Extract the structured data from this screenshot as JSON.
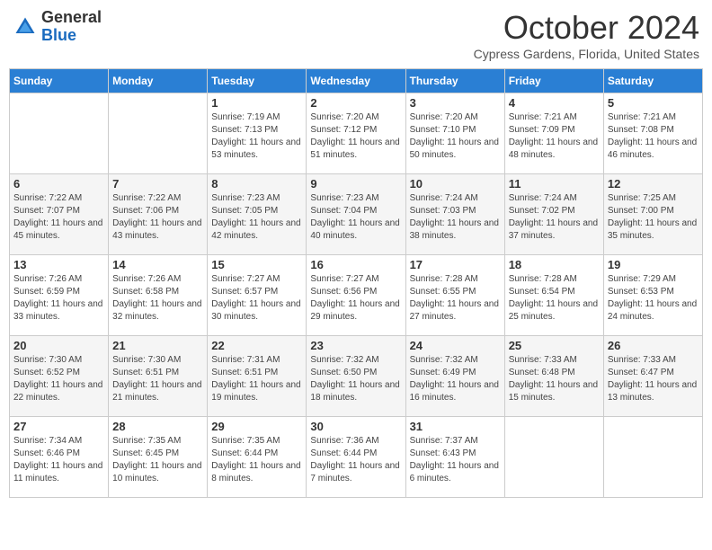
{
  "header": {
    "logo": {
      "general": "General",
      "blue": "Blue"
    },
    "title": "October 2024",
    "location": "Cypress Gardens, Florida, United States"
  },
  "days_of_week": [
    "Sunday",
    "Monday",
    "Tuesday",
    "Wednesday",
    "Thursday",
    "Friday",
    "Saturday"
  ],
  "weeks": [
    [
      {
        "day": "",
        "info": ""
      },
      {
        "day": "",
        "info": ""
      },
      {
        "day": "1",
        "info": "Sunrise: 7:19 AM\nSunset: 7:13 PM\nDaylight: 11 hours and 53 minutes."
      },
      {
        "day": "2",
        "info": "Sunrise: 7:20 AM\nSunset: 7:12 PM\nDaylight: 11 hours and 51 minutes."
      },
      {
        "day": "3",
        "info": "Sunrise: 7:20 AM\nSunset: 7:10 PM\nDaylight: 11 hours and 50 minutes."
      },
      {
        "day": "4",
        "info": "Sunrise: 7:21 AM\nSunset: 7:09 PM\nDaylight: 11 hours and 48 minutes."
      },
      {
        "day": "5",
        "info": "Sunrise: 7:21 AM\nSunset: 7:08 PM\nDaylight: 11 hours and 46 minutes."
      }
    ],
    [
      {
        "day": "6",
        "info": "Sunrise: 7:22 AM\nSunset: 7:07 PM\nDaylight: 11 hours and 45 minutes."
      },
      {
        "day": "7",
        "info": "Sunrise: 7:22 AM\nSunset: 7:06 PM\nDaylight: 11 hours and 43 minutes."
      },
      {
        "day": "8",
        "info": "Sunrise: 7:23 AM\nSunset: 7:05 PM\nDaylight: 11 hours and 42 minutes."
      },
      {
        "day": "9",
        "info": "Sunrise: 7:23 AM\nSunset: 7:04 PM\nDaylight: 11 hours and 40 minutes."
      },
      {
        "day": "10",
        "info": "Sunrise: 7:24 AM\nSunset: 7:03 PM\nDaylight: 11 hours and 38 minutes."
      },
      {
        "day": "11",
        "info": "Sunrise: 7:24 AM\nSunset: 7:02 PM\nDaylight: 11 hours and 37 minutes."
      },
      {
        "day": "12",
        "info": "Sunrise: 7:25 AM\nSunset: 7:00 PM\nDaylight: 11 hours and 35 minutes."
      }
    ],
    [
      {
        "day": "13",
        "info": "Sunrise: 7:26 AM\nSunset: 6:59 PM\nDaylight: 11 hours and 33 minutes."
      },
      {
        "day": "14",
        "info": "Sunrise: 7:26 AM\nSunset: 6:58 PM\nDaylight: 11 hours and 32 minutes."
      },
      {
        "day": "15",
        "info": "Sunrise: 7:27 AM\nSunset: 6:57 PM\nDaylight: 11 hours and 30 minutes."
      },
      {
        "day": "16",
        "info": "Sunrise: 7:27 AM\nSunset: 6:56 PM\nDaylight: 11 hours and 29 minutes."
      },
      {
        "day": "17",
        "info": "Sunrise: 7:28 AM\nSunset: 6:55 PM\nDaylight: 11 hours and 27 minutes."
      },
      {
        "day": "18",
        "info": "Sunrise: 7:28 AM\nSunset: 6:54 PM\nDaylight: 11 hours and 25 minutes."
      },
      {
        "day": "19",
        "info": "Sunrise: 7:29 AM\nSunset: 6:53 PM\nDaylight: 11 hours and 24 minutes."
      }
    ],
    [
      {
        "day": "20",
        "info": "Sunrise: 7:30 AM\nSunset: 6:52 PM\nDaylight: 11 hours and 22 minutes."
      },
      {
        "day": "21",
        "info": "Sunrise: 7:30 AM\nSunset: 6:51 PM\nDaylight: 11 hours and 21 minutes."
      },
      {
        "day": "22",
        "info": "Sunrise: 7:31 AM\nSunset: 6:51 PM\nDaylight: 11 hours and 19 minutes."
      },
      {
        "day": "23",
        "info": "Sunrise: 7:32 AM\nSunset: 6:50 PM\nDaylight: 11 hours and 18 minutes."
      },
      {
        "day": "24",
        "info": "Sunrise: 7:32 AM\nSunset: 6:49 PM\nDaylight: 11 hours and 16 minutes."
      },
      {
        "day": "25",
        "info": "Sunrise: 7:33 AM\nSunset: 6:48 PM\nDaylight: 11 hours and 15 minutes."
      },
      {
        "day": "26",
        "info": "Sunrise: 7:33 AM\nSunset: 6:47 PM\nDaylight: 11 hours and 13 minutes."
      }
    ],
    [
      {
        "day": "27",
        "info": "Sunrise: 7:34 AM\nSunset: 6:46 PM\nDaylight: 11 hours and 11 minutes."
      },
      {
        "day": "28",
        "info": "Sunrise: 7:35 AM\nSunset: 6:45 PM\nDaylight: 11 hours and 10 minutes."
      },
      {
        "day": "29",
        "info": "Sunrise: 7:35 AM\nSunset: 6:44 PM\nDaylight: 11 hours and 8 minutes."
      },
      {
        "day": "30",
        "info": "Sunrise: 7:36 AM\nSunset: 6:44 PM\nDaylight: 11 hours and 7 minutes."
      },
      {
        "day": "31",
        "info": "Sunrise: 7:37 AM\nSunset: 6:43 PM\nDaylight: 11 hours and 6 minutes."
      },
      {
        "day": "",
        "info": ""
      },
      {
        "day": "",
        "info": ""
      }
    ]
  ]
}
